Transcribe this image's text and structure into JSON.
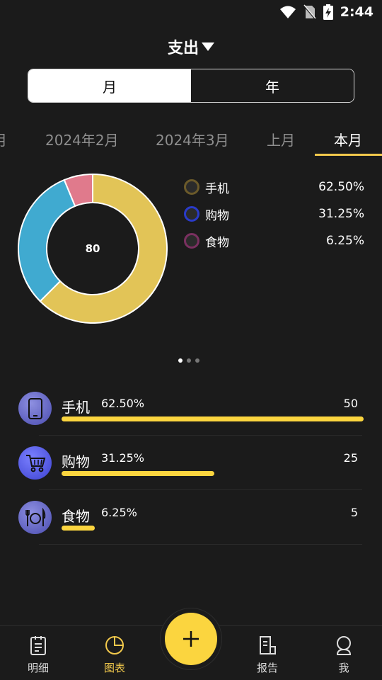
{
  "status": {
    "time": "2:44"
  },
  "header": {
    "title": "支出"
  },
  "segment": {
    "month": "月",
    "year": "年"
  },
  "period_tabs": [
    {
      "label": "月"
    },
    {
      "label": "2024年2月"
    },
    {
      "label": "2024年3月"
    },
    {
      "label": "上月"
    },
    {
      "label": "本月"
    }
  ],
  "donut": {
    "center_label": "80",
    "colors": {
      "phone": "#e2c457",
      "shopping": "#40aad0",
      "food": "#e07a8c"
    }
  },
  "legend": [
    {
      "name": "手机",
      "pct": "62.50%",
      "color": "#6b5a2a"
    },
    {
      "name": "购物",
      "pct": "31.25%",
      "color": "#2a3bc9"
    },
    {
      "name": "食物",
      "pct": "6.25%",
      "color": "#7a3060"
    }
  ],
  "categories": [
    {
      "name": "手机",
      "pct": "62.50%",
      "amount": "50",
      "share": 1.0,
      "icon": "phone-icon"
    },
    {
      "name": "购物",
      "pct": "31.25%",
      "amount": "25",
      "share": 0.5,
      "icon": "shopping-cart-icon"
    },
    {
      "name": "食物",
      "pct": "6.25%",
      "amount": "5",
      "share": 0.11,
      "icon": "food-plate-icon"
    }
  ],
  "nav": {
    "detail": "明细",
    "chart": "图表",
    "report": "报告",
    "me": "我"
  },
  "accent_color": "#fbd53f"
}
